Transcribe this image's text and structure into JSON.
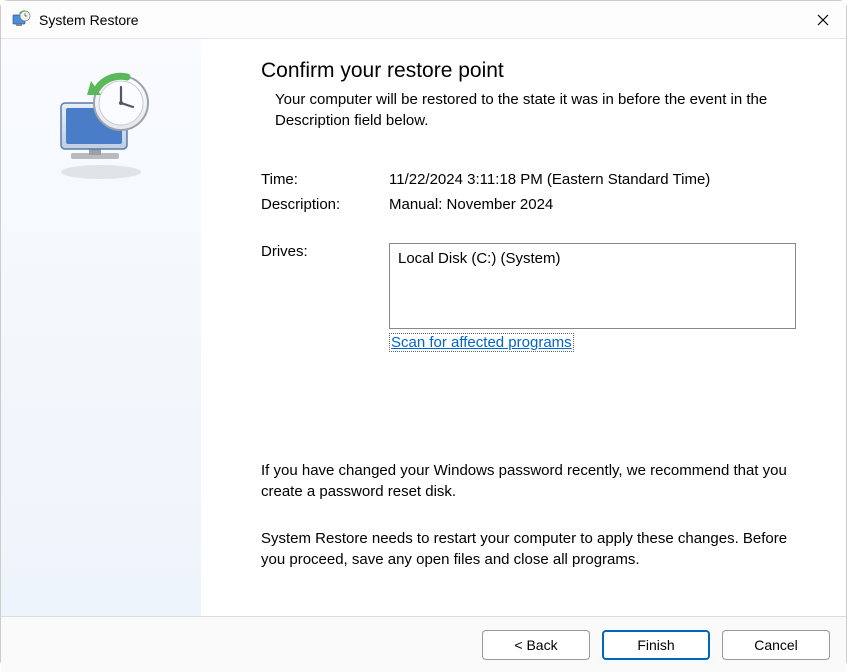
{
  "titlebar": {
    "title": "System Restore"
  },
  "main": {
    "heading": "Confirm your restore point",
    "subtitle": "Your computer will be restored to the state it was in before the event in the Description field below.",
    "time_label": "Time:",
    "time_value": "11/22/2024 3:11:18 PM (Eastern Standard Time)",
    "description_label": "Description:",
    "description_value": "Manual: November 2024",
    "drives_label": "Drives:",
    "drives_value": "Local Disk (C:) (System)",
    "scan_link": "Scan for affected programs",
    "info1": "If you have changed your Windows password recently, we recommend that you create a password reset disk.",
    "info2": "System Restore needs to restart your computer to apply these changes. Before you proceed, save any open files and close all programs."
  },
  "footer": {
    "back": "< Back",
    "finish": "Finish",
    "cancel": "Cancel"
  }
}
